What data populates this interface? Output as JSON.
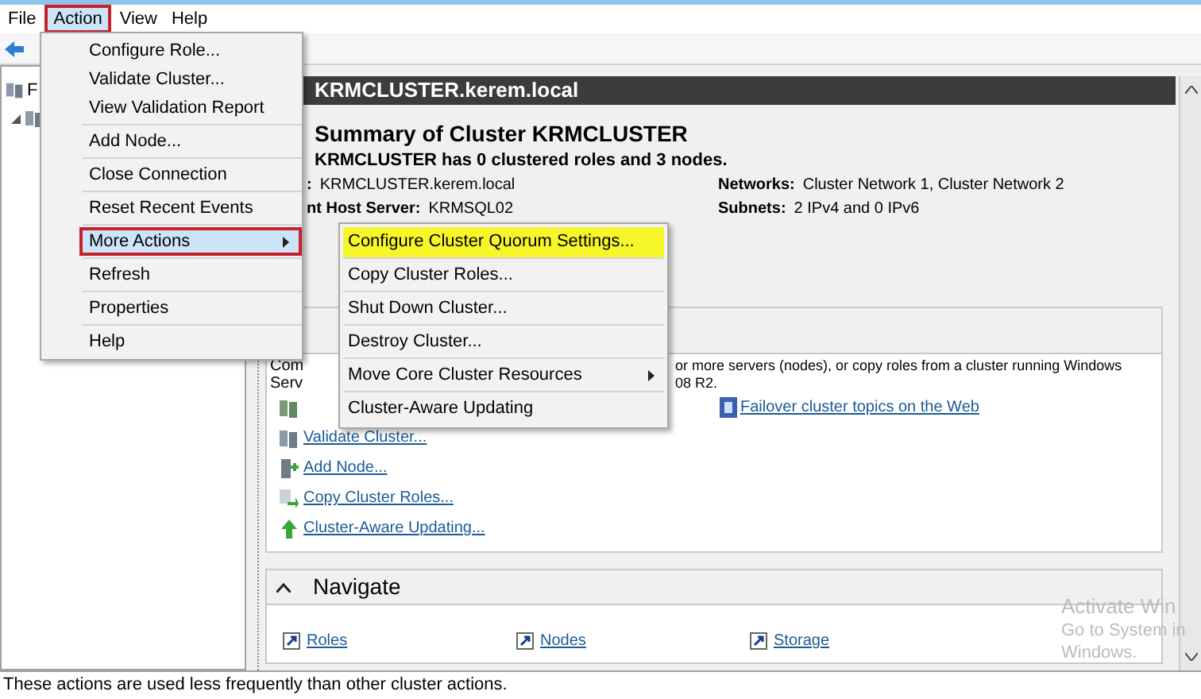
{
  "menu_bar": [
    {
      "label": "File",
      "selected": false
    },
    {
      "label": "Action",
      "selected": true
    },
    {
      "label": "View",
      "selected": false
    },
    {
      "label": "Help",
      "selected": false
    }
  ],
  "tree": {
    "label": "F"
  },
  "header": {
    "title": "KRMCLUSTER.kerem.local"
  },
  "summary": {
    "title": "Summary of Cluster KRMCLUSTER",
    "subtitle": "KRMCLUSTER has 0 clustered roles and 3 nodes.",
    "left_details": [
      {
        "label": ":",
        "value": "KRMCLUSTER.kerem.local"
      },
      {
        "label": "nt Host Server:",
        "value": "KRMSQL02"
      }
    ],
    "right_details": [
      {
        "label": "Networks:",
        "value": "Cluster Network 1, Cluster Network 2"
      },
      {
        "label": "Subnets:",
        "value": "2 IPv4 and 0 IPv6"
      }
    ]
  },
  "configure_panel": {
    "fragments": [
      "Com",
      "Serv"
    ],
    "description": [
      "or more servers (nodes), or copy roles from a cluster running Windows",
      "08 R2."
    ],
    "links": [
      "Validate Cluster...",
      "Add Node...",
      "Copy Cluster Roles...",
      "Cluster-Aware Updating..."
    ],
    "web_link": "Failover cluster topics on the Web"
  },
  "navigate_panel": {
    "title": "Navigate",
    "expanded": true,
    "links": [
      "Roles",
      "Nodes",
      "Storage"
    ]
  },
  "action_menu": [
    [
      {
        "label": "Configure Role...",
        "selected": false,
        "has_submenu": false
      },
      {
        "label": "Validate Cluster...",
        "selected": false,
        "has_submenu": false
      },
      {
        "label": "View Validation Report",
        "selected": false,
        "has_submenu": false
      }
    ],
    [
      {
        "label": "Add Node...",
        "selected": false,
        "has_submenu": false
      }
    ],
    [
      {
        "label": "Close Connection",
        "selected": false,
        "has_submenu": false
      }
    ],
    [
      {
        "label": "Reset Recent Events",
        "selected": false,
        "has_submenu": false
      }
    ],
    [
      {
        "label": "More Actions",
        "selected": true,
        "has_submenu": true
      }
    ],
    [
      {
        "label": "Refresh",
        "selected": false,
        "has_submenu": false
      }
    ],
    [
      {
        "label": "Properties",
        "selected": false,
        "has_submenu": false
      }
    ],
    [
      {
        "label": "Help",
        "selected": false,
        "has_submenu": false
      }
    ]
  ],
  "more_actions_submenu": [
    {
      "label": "Configure Cluster Quorum Settings...",
      "selected": true,
      "has_submenu": false
    },
    {
      "label": "Copy Cluster Roles...",
      "selected": false,
      "has_submenu": false
    },
    {
      "label": "Shut Down Cluster...",
      "selected": false,
      "has_submenu": false
    },
    {
      "label": "Destroy Cluster...",
      "selected": false,
      "has_submenu": false
    },
    {
      "label": "Move Core Cluster Resources",
      "selected": false,
      "has_submenu": true
    },
    {
      "label": "Cluster-Aware Updating",
      "selected": false,
      "has_submenu": false
    }
  ],
  "system_overlay": [
    "Activate Win",
    "Go to System in",
    "Windows."
  ],
  "status_bar": "These actions are used less frequently than other cluster actions."
}
